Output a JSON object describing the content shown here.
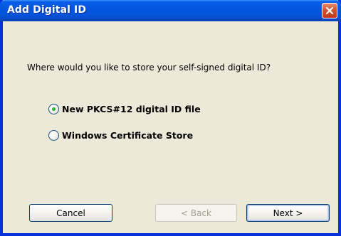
{
  "window": {
    "title": "Add Digital ID",
    "close_icon": "close-icon"
  },
  "dialog": {
    "question": "Where would you like to store your self-signed digital ID?",
    "options": [
      {
        "label": "New PKCS#12 digital ID file",
        "selected": true
      },
      {
        "label": "Windows Certificate Store",
        "selected": false
      }
    ]
  },
  "buttons": {
    "cancel_label": "Cancel",
    "back_label": "< Back",
    "next_label": "Next >",
    "back_enabled": false
  },
  "colors": {
    "titlebar": "#0555E0",
    "dialog_bg": "#ECE9D8",
    "close_button": "#D2542E",
    "radio_selected_dot": "#21A121"
  }
}
